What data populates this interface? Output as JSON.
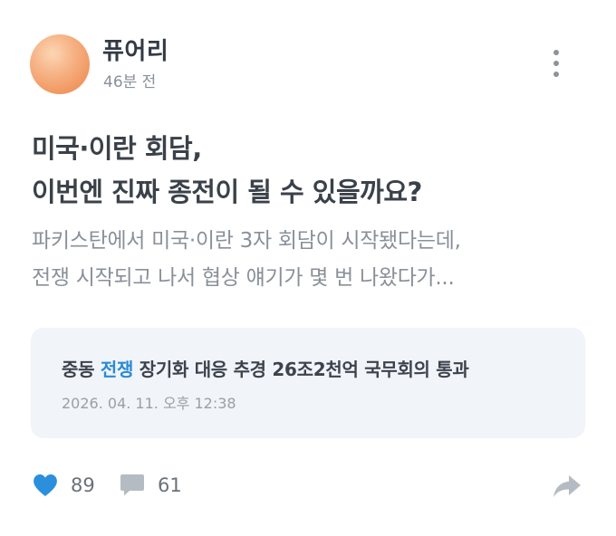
{
  "author": {
    "name": "퓨어리",
    "time": "46분 전"
  },
  "post": {
    "title_line1": "미국·이란 회담,",
    "title_line2": "이번엔 진짜 종전이 될 수 있을까요?",
    "preview_line1": "파키스탄에서 미국·이란 3자 회담이 시작됐다는데,",
    "preview_line2": "전쟁 시작되고 나서 협상 얘기가 몇 번 나왔다가..."
  },
  "news": {
    "headline_pre": "중동 ",
    "headline_highlight": "전쟁",
    "headline_post": " 장기화 대응 추경 26조2천억 국무회의 통과",
    "date": "2026. 04. 11. 오후 12:38"
  },
  "actions": {
    "like_count": "89",
    "comment_count": "61"
  },
  "colors": {
    "accent": "#2a8bd6",
    "heart": "#2b8fdc",
    "news_bg": "#f1f4f8"
  },
  "icons": {
    "more": "more-vertical-icon",
    "like": "heart-icon",
    "comment": "speech-bubble-icon",
    "share": "share-arrow-icon"
  }
}
